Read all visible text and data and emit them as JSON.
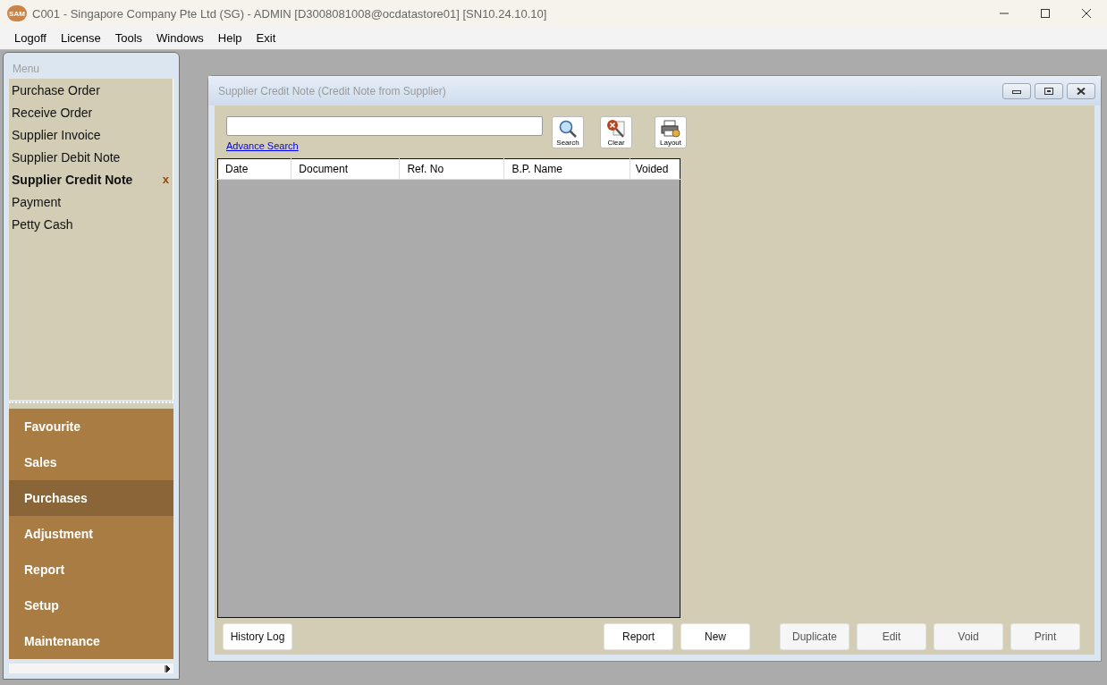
{
  "window": {
    "logo": "SAM",
    "title": "C001 - Singapore Company Pte Ltd (SG) - ADMIN [D3008081008@ocdatastore01] [SN10.24.10.10]"
  },
  "menu_bar": [
    "Logoff",
    "License",
    "Tools",
    "Windows",
    "Help",
    "Exit"
  ],
  "sidebar": {
    "heading": "Menu",
    "items": [
      {
        "label": "Purchase Order",
        "selected": false
      },
      {
        "label": "Receive Order",
        "selected": false
      },
      {
        "label": "Supplier Invoice",
        "selected": false
      },
      {
        "label": "Supplier Debit Note",
        "selected": false
      },
      {
        "label": "Supplier Credit Note",
        "selected": true,
        "close_mark": "x"
      },
      {
        "label": "Payment",
        "selected": false
      },
      {
        "label": "Petty Cash",
        "selected": false
      }
    ],
    "sections": [
      {
        "label": "Favourite",
        "selected": false
      },
      {
        "label": "Sales",
        "selected": false
      },
      {
        "label": "Purchases",
        "selected": true
      },
      {
        "label": "Adjustment",
        "selected": false
      },
      {
        "label": "Report",
        "selected": false
      },
      {
        "label": "Setup",
        "selected": false
      },
      {
        "label": "Maintenance",
        "selected": false
      }
    ]
  },
  "child_window": {
    "title": "Supplier Credit Note (Credit Note from Supplier)",
    "search_link": "Advance Search",
    "tool_buttons": [
      {
        "label": "Search",
        "kind": "search"
      },
      {
        "label": "Clear",
        "kind": "clear"
      },
      {
        "label": "Layout",
        "kind": "layout"
      }
    ],
    "table": {
      "columns": [
        "Date",
        "Document",
        "Ref. No",
        "B.P. Name",
        "Voided"
      ]
    },
    "buttons": [
      {
        "label": "History Log",
        "disabled": false
      },
      {
        "label": "Report",
        "disabled": false
      },
      {
        "label": "New",
        "disabled": false
      },
      {
        "label": "Duplicate",
        "disabled": true
      },
      {
        "label": "Edit",
        "disabled": true
      },
      {
        "label": "Void",
        "disabled": true
      },
      {
        "label": "Print",
        "disabled": true
      }
    ]
  }
}
